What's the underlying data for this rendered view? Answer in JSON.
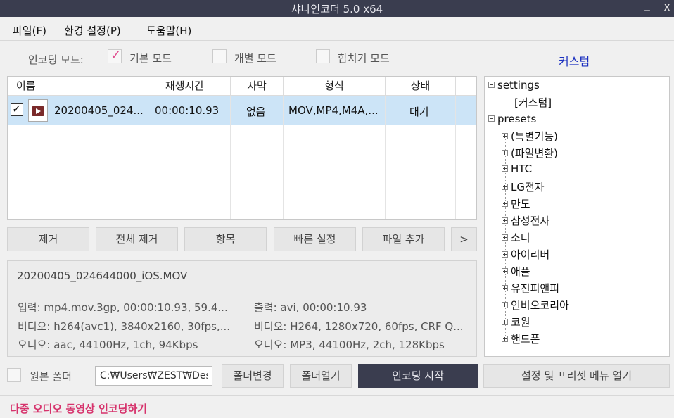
{
  "window": {
    "title": "샤나인코더  5.0 x64",
    "minimize": "_",
    "close": "X"
  },
  "menu": {
    "file": "파일(F)",
    "settings": "환경 설정(P)",
    "help": "도움말(H)"
  },
  "mode": {
    "label": "인코딩 모드:",
    "basic": "기본 모드",
    "individual": "개별 모드",
    "merge": "합치기 모드",
    "basic_checked_mark": "✓",
    "custom_link": "커스텀"
  },
  "table": {
    "headers": {
      "name": "이름",
      "duration": "재생시간",
      "subtitle": "자막",
      "format": "형식",
      "status": "상태"
    },
    "rows": [
      {
        "checked_mark": "✓",
        "name": "20200405_024...",
        "duration": "00:00:10.93",
        "subtitle": "없음",
        "format": "MOV,MP4,M4A,...",
        "status": "대기"
      }
    ]
  },
  "buttons": {
    "remove": "제거",
    "remove_all": "전체 제거",
    "items": "항목",
    "quick_settings": "빠른 설정",
    "add_file": "파일 추가",
    "more": ">"
  },
  "info": {
    "filename": "20200405_024644000_iOS.MOV",
    "input": "입력: mp4.mov.3gp, 00:00:10.93, 59.4...",
    "input_video": "비디오: h264(avc1), 3840x2160, 30fps,...",
    "input_audio": "오디오: aac, 44100Hz, 1ch, 94Kbps",
    "output": "출력: avi, 00:00:10.93",
    "output_video": "비디오: H264, 1280x720, 60fps, CRF Q...",
    "output_audio": "오디오: MP3, 44100Hz, 2ch, 128Kbps"
  },
  "tree": {
    "settings": "settings",
    "settings_children": [
      "[커스텀]"
    ],
    "presets": "presets",
    "presets_children": [
      "(특별기능)",
      "(파일변환)",
      "HTC",
      "LG전자",
      "만도",
      "삼성전자",
      "소니",
      "아이리버",
      "애플",
      "유진피앤피",
      "인비오코리아",
      "코원",
      "핸드폰"
    ]
  },
  "bottom": {
    "source_folder": "원본 폴더",
    "path_value": "C:₩Users₩ZEST₩Desl",
    "change_folder": "폴더변경",
    "open_folder": "폴더열기",
    "start_encoding": "인코딩 시작",
    "open_menu": "설정 및 프리셋 메뉴 열기"
  },
  "status": {
    "text": "다중 오디오 동영상 인코딩하기"
  },
  "colors": {
    "titlebar": "#3a3d4f",
    "selected_row": "#cce4f7",
    "status_text": "#d6336c",
    "link": "#1a2fbf",
    "check_mark": "#e05090"
  }
}
